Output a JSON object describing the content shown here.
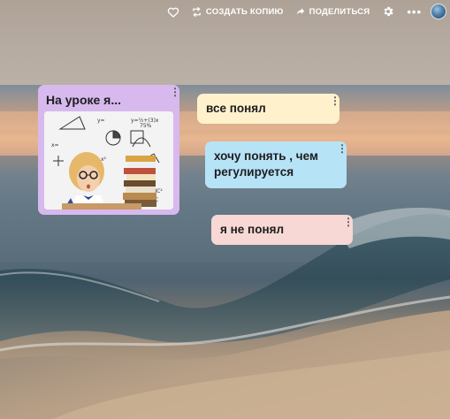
{
  "toolbar": {
    "copy_label": "СОЗДАТЬ КОПИЮ",
    "share_label": "ПОДЕЛИТЬСЯ",
    "more_label": "•••"
  },
  "cards": {
    "image_card_title": "На уроке я...",
    "card_a": "все понял",
    "card_b": "хочу понять , чем регулируется",
    "card_c": "я не понял"
  },
  "colors": {
    "image_card": "#d7b9ee",
    "card_a": "#fff1cc",
    "card_b": "#b7e3f7",
    "card_c": "#f7d8d4"
  },
  "icons": [
    "heart-icon",
    "copy-icon",
    "share-arrow-icon",
    "gear-icon",
    "more-dots-icon",
    "avatar"
  ]
}
